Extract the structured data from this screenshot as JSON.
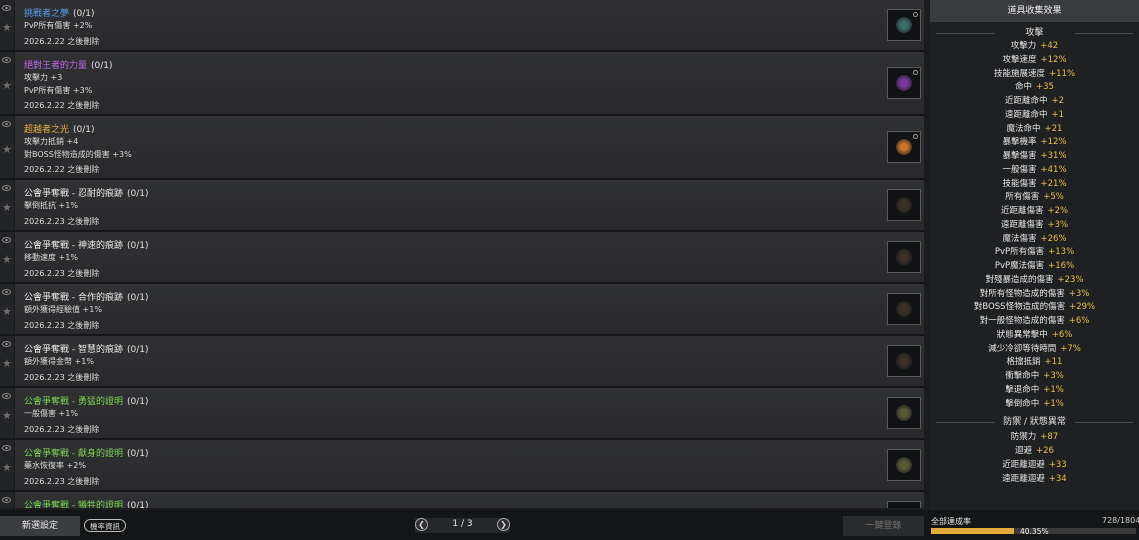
{
  "items": [
    {
      "title": "挑戰者之夢",
      "count": "(0/1)",
      "color": "#5a9df0",
      "effects": [
        "PvP所有傷害 +2%"
      ],
      "date": "2026.2.22 之後刪除",
      "icon": "helmet-icon",
      "gem": "#3f6f6a"
    },
    {
      "title": "絕對王者的力量",
      "count": "(0/1)",
      "color": "#c06ae8",
      "effects": [
        "攻擊力 +3",
        "PvP所有傷害 +3%"
      ],
      "date": "2026.2.22 之後刪除",
      "icon": "helmet-icon",
      "gem": "#7a3aa0"
    },
    {
      "title": "超越者之光",
      "count": "(0/1)",
      "color": "#e9b343",
      "effects": [
        "攻擊力抵銷 +4",
        "對BOSS怪物造成的傷害 +3%"
      ],
      "date": "2026.2.22 之後刪除",
      "icon": "helmet-icon",
      "gem": "#c8742a"
    },
    {
      "title": "公會爭奪戰 - 忍耐的痕跡",
      "count": "(0/1)",
      "color": "#ececec",
      "effects": [
        "擊倒抵抗 +1%"
      ],
      "date": "2026.2.23 之後刪除",
      "icon": "emblem-icon",
      "gem": "#3a3228"
    },
    {
      "title": "公會爭奪戰 - 神速的痕跡",
      "count": "(0/1)",
      "color": "#ececec",
      "effects": [
        "移動速度 +1%"
      ],
      "date": "2026.2.23 之後刪除",
      "icon": "emblem-icon",
      "gem": "#3a3228"
    },
    {
      "title": "公會爭奪戰 - 合作的痕跡",
      "count": "(0/1)",
      "color": "#ececec",
      "effects": [
        "額外獲得經驗值 +1%"
      ],
      "date": "2026.2.23 之後刪除",
      "icon": "emblem-icon",
      "gem": "#3a3228"
    },
    {
      "title": "公會爭奪戰 - 智慧的痕跡",
      "count": "(0/1)",
      "color": "#ececec",
      "effects": [
        "額外獲得金幣 +1%"
      ],
      "date": "2026.2.23 之後刪除",
      "icon": "emblem-icon",
      "gem": "#3a3228"
    },
    {
      "title": "公會爭奪戰 - 勇猛的證明",
      "count": "(0/1)",
      "color": "#7cd453",
      "effects": [
        "一般傷害 +1%"
      ],
      "date": "2026.2.23 之後刪除",
      "icon": "emblem-icon",
      "gem": "#5a5a3a"
    },
    {
      "title": "公會爭奪戰 - 獻身的證明",
      "count": "(0/1)",
      "color": "#7cd453",
      "effects": [
        "藥水恢復率 +2%"
      ],
      "date": "2026.2.23 之後刪除",
      "icon": "emblem-icon",
      "gem": "#5a5a3a"
    },
    {
      "title": "公會爭奪戰 - 犧牲的證明",
      "count": "(0/1)",
      "color": "#7cd453",
      "effects": [],
      "date": "",
      "icon": "emblem-icon",
      "gem": "#5a5a3a"
    }
  ],
  "panel": {
    "header": "道具收集效果",
    "attack_title": "攻擊",
    "attack": [
      {
        "label": "攻擊力",
        "value": "+42"
      },
      {
        "label": "攻擊速度",
        "value": "+12%"
      },
      {
        "label": "技能施展速度",
        "value": "+11%"
      },
      {
        "label": "命中",
        "value": "+35"
      },
      {
        "label": "近距離命中",
        "value": "+2"
      },
      {
        "label": "遠距離命中",
        "value": "+1"
      },
      {
        "label": "魔法命中",
        "value": "+21"
      },
      {
        "label": "暴擊機率",
        "value": "+12%"
      },
      {
        "label": "暴擊傷害",
        "value": "+31%"
      },
      {
        "label": "一般傷害",
        "value": "+41%"
      },
      {
        "label": "技能傷害",
        "value": "+21%"
      },
      {
        "label": "所有傷害",
        "value": "+5%"
      },
      {
        "label": "近距離傷害",
        "value": "+2%"
      },
      {
        "label": "遠距離傷害",
        "value": "+3%"
      },
      {
        "label": "魔法傷害",
        "value": "+26%"
      },
      {
        "label": "PvP所有傷害",
        "value": "+13%"
      },
      {
        "label": "PvP魔法傷害",
        "value": "+16%"
      },
      {
        "label": "對殘暴造成的傷害",
        "value": "+23%"
      },
      {
        "label": "對所有怪物造成的傷害",
        "value": "+3%"
      },
      {
        "label": "對BOSS怪物造成的傷害",
        "value": "+29%"
      },
      {
        "label": "對一般怪物造成的傷害",
        "value": "+6%"
      },
      {
        "label": "狀態異常擊中",
        "value": "+6%"
      },
      {
        "label": "減少冷卻等待時間",
        "value": "+7%"
      },
      {
        "label": "格擋抵銷",
        "value": "+11"
      },
      {
        "label": "衝擊命中",
        "value": "+3%"
      },
      {
        "label": "擊退命中",
        "value": "+1%"
      },
      {
        "label": "擊倒命中",
        "value": "+1%"
      }
    ],
    "defense_title": "防禦 / 狀態異常",
    "defense": [
      {
        "label": "防禦力",
        "value": "+87"
      },
      {
        "label": "迴避",
        "value": "+26"
      },
      {
        "label": "近距離迴避",
        "value": "+33"
      },
      {
        "label": "遠距離迴避",
        "value": "+34"
      }
    ]
  },
  "bottom": {
    "new_settings": "新選設定",
    "rate_info": "機率資訊",
    "page": "1 / 3",
    "register": "一鍵登錄",
    "completion_label": "全部達成率",
    "completion_count": "728/1804",
    "completion_pct": "40.35%",
    "completion_fraction": 0.4035,
    "accent": "#e2aa3a"
  }
}
